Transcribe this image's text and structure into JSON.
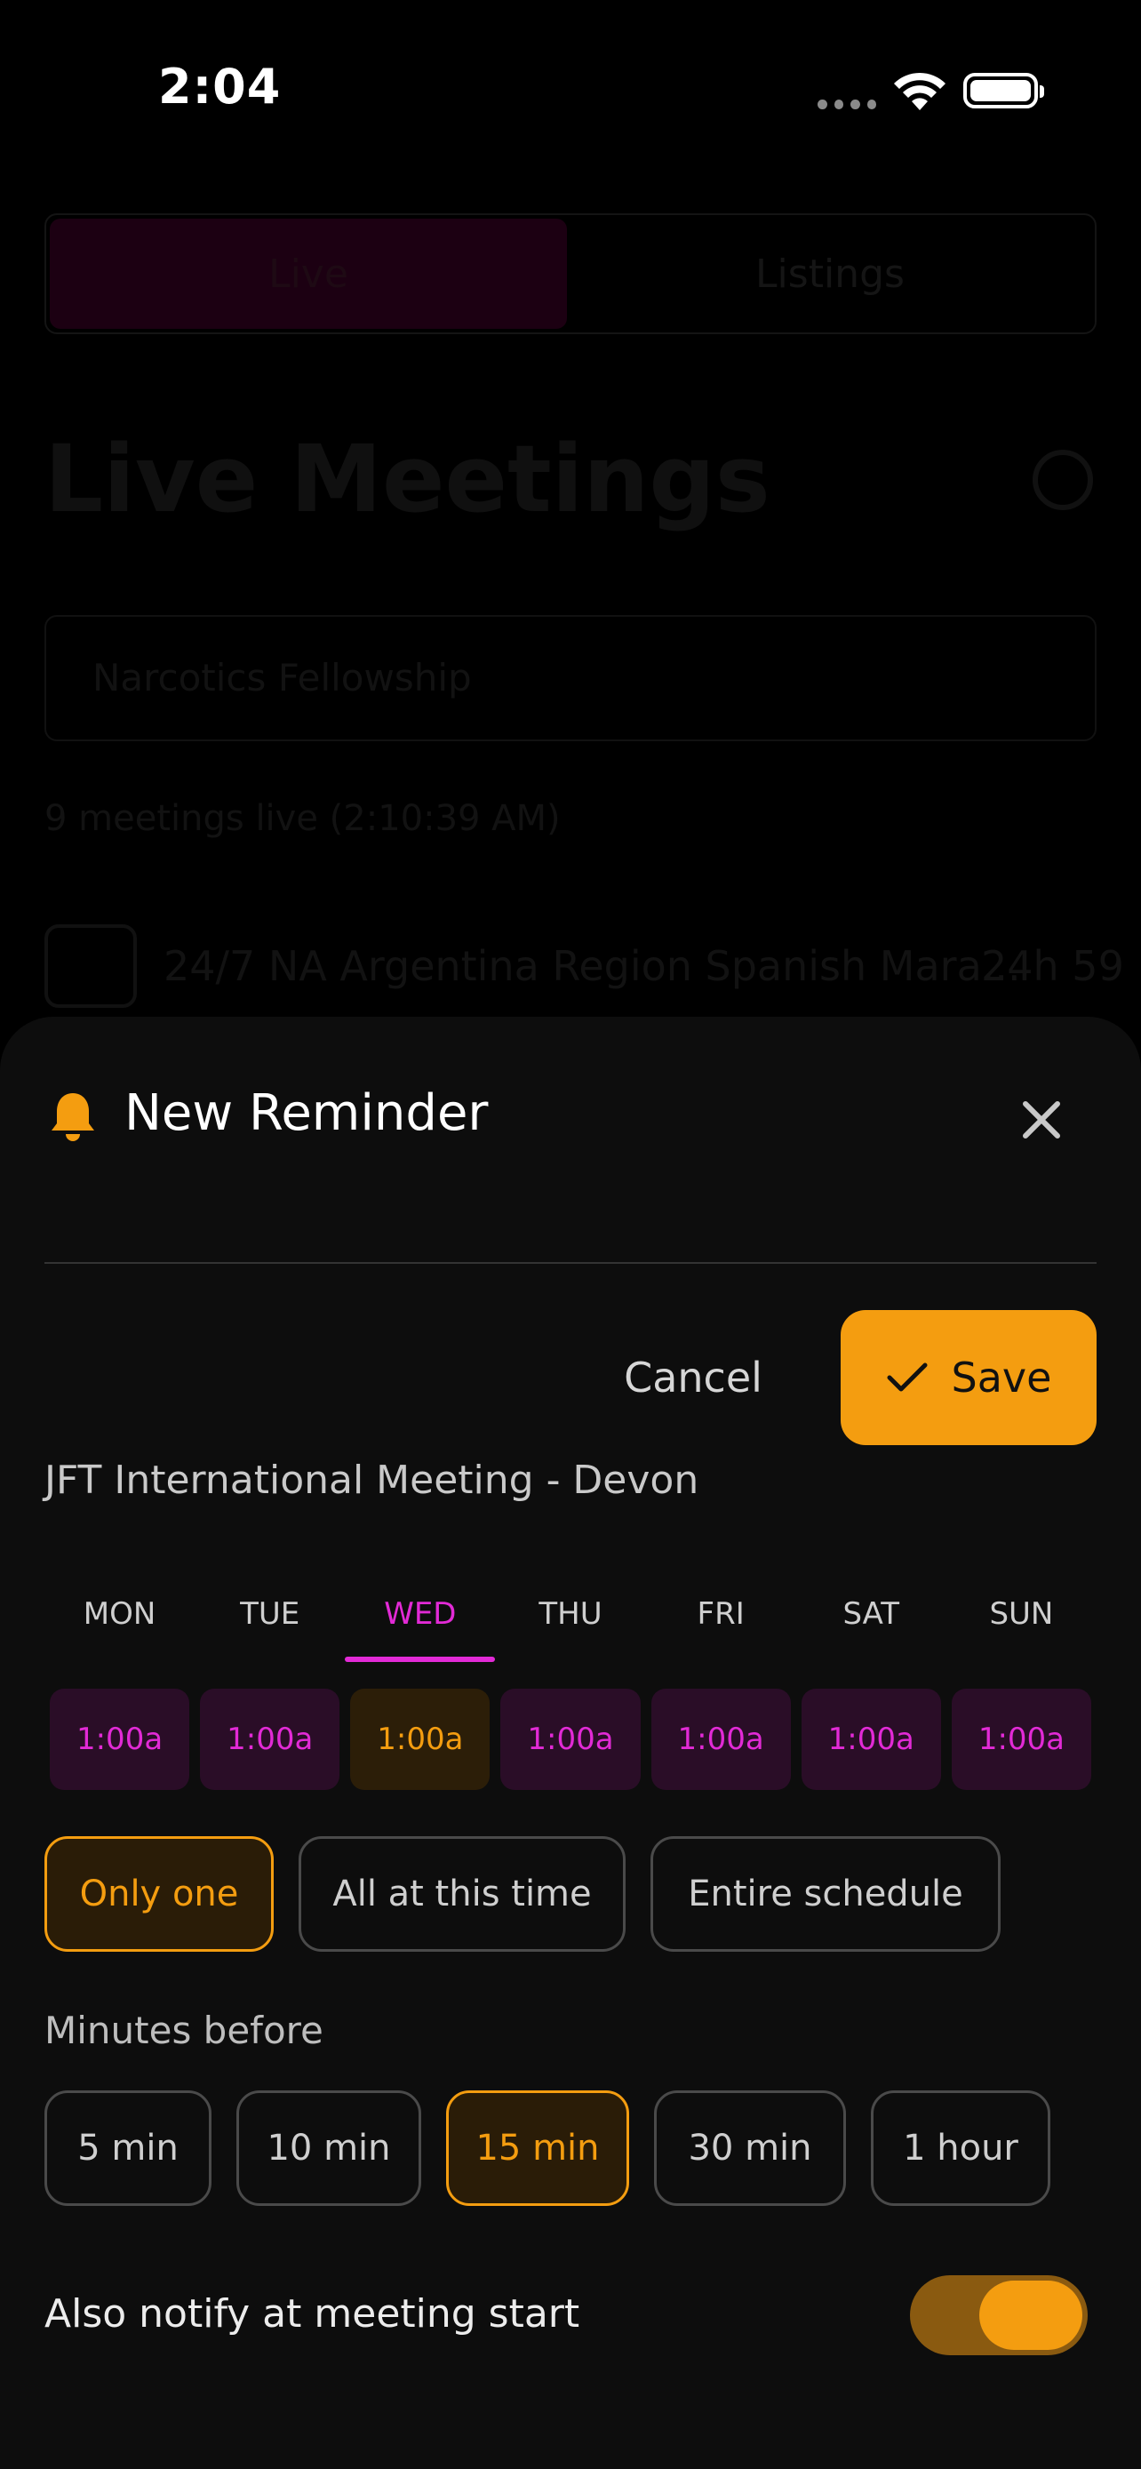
{
  "status_bar": {
    "time": "2:04"
  },
  "background": {
    "tabs": {
      "live": "Live",
      "listings": "Listings"
    },
    "title": "Live Meetings",
    "search_value": "Narcotics Fellowship",
    "count_text": "9 meetings live (2:10:39 AM)",
    "row_name": "24/7 NA Argentina Region Spanish Mara...",
    "row_duration": "24h 59"
  },
  "sheet": {
    "title": "New Reminder",
    "cancel_label": "Cancel",
    "save_label": "Save",
    "meeting_name": "JFT International Meeting - Devon",
    "days": [
      {
        "label": "MON",
        "time": "1:00a"
      },
      {
        "label": "TUE",
        "time": "1:00a"
      },
      {
        "label": "WED",
        "time": "1:00a",
        "selected": true
      },
      {
        "label": "THU",
        "time": "1:00a"
      },
      {
        "label": "FRI",
        "time": "1:00a"
      },
      {
        "label": "SAT",
        "time": "1:00a"
      },
      {
        "label": "SUN",
        "time": "1:00a"
      }
    ],
    "scope_options": [
      "Only one",
      "All at this time",
      "Entire schedule"
    ],
    "scope_selected": "Only one",
    "minutes_label": "Minutes before",
    "minute_options": [
      "5 min",
      "10 min",
      "15 min",
      "30 min",
      "1 hour"
    ],
    "minute_selected": "15 min",
    "notify_label": "Also notify at meeting start",
    "notify_enabled": true
  },
  "colors": {
    "accent": "#f49d10",
    "magenta": "#e22ad6",
    "sheet_bg": "#0d0d0d"
  }
}
